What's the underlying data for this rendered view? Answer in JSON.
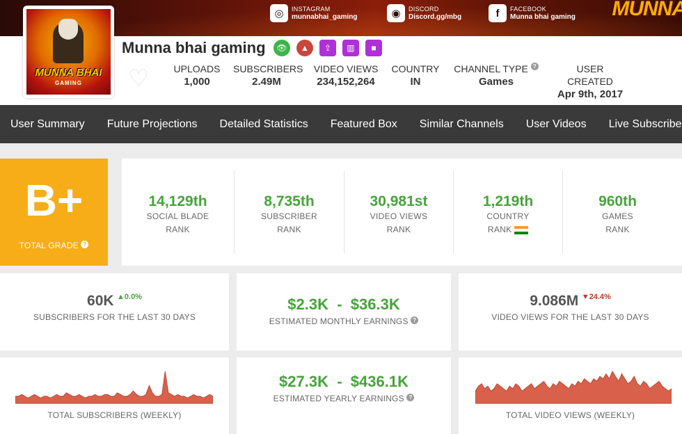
{
  "banner": {
    "instagram": {
      "label": "INSTAGRAM",
      "handle": "munnabhai_gaming"
    },
    "discord": {
      "label": "DISCORD",
      "handle": "Discord.gg/mbg"
    },
    "facebook": {
      "label": "FACEBOOK",
      "handle": "Munna bhai gaming"
    },
    "brand": "MUNNA"
  },
  "channel": {
    "name": "Munna bhai gaming",
    "avatar_text": "MUNNA BHAI",
    "avatar_sub": "GAMING"
  },
  "stats": [
    {
      "label": "UPLOADS",
      "value": "1,000"
    },
    {
      "label": "SUBSCRIBERS",
      "value": "2.49M"
    },
    {
      "label": "VIDEO VIEWS",
      "value": "234,152,264"
    },
    {
      "label": "COUNTRY",
      "value": "IN"
    },
    {
      "label": "CHANNEL TYPE",
      "value": "Games"
    },
    {
      "label": "USER CREATED",
      "value": "Apr 9th, 2017"
    }
  ],
  "nav": [
    "User Summary",
    "Future Projections",
    "Detailed Statistics",
    "Featured Box",
    "Similar Channels",
    "User Videos",
    "Live Subscriber"
  ],
  "grade": {
    "value": "B+",
    "label": "TOTAL GRADE"
  },
  "ranks": [
    {
      "value": "14,129th",
      "line1": "SOCIAL BLADE",
      "line2": "RANK"
    },
    {
      "value": "8,735th",
      "line1": "SUBSCRIBER",
      "line2": "RANK"
    },
    {
      "value": "30,981st",
      "line1": "VIDEO VIEWS",
      "line2": "RANK"
    },
    {
      "value": "1,219th",
      "line1": "COUNTRY",
      "line2": "RANK"
    },
    {
      "value": "960th",
      "line1": "GAMES",
      "line2": "RANK"
    }
  ],
  "cards": {
    "subs30": {
      "value": "60K",
      "delta": "0.0%",
      "caption": "SUBSCRIBERS FOR THE LAST 30 DAYS"
    },
    "monthly": {
      "low": "$2.3K",
      "sep": "-",
      "high": "$36.3K",
      "caption": "ESTIMATED MONTHLY EARNINGS"
    },
    "views30": {
      "value": "9.086M",
      "delta": "24.4%",
      "caption": "VIDEO VIEWS FOR THE LAST 30 DAYS"
    },
    "total_subs": {
      "caption": "TOTAL SUBSCRIBERS (WEEKLY)"
    },
    "yearly": {
      "low": "$27.3K",
      "sep": "-",
      "high": "$436.1K",
      "caption": "ESTIMATED YEARLY EARNINGS"
    },
    "total_views": {
      "caption": "TOTAL VIDEO VIEWS (WEEKLY)"
    }
  },
  "colors": {
    "accent_green": "#46a33b",
    "grade_orange": "#f6ad17",
    "nav_bg": "#3a3a3a",
    "spark_fill": "#d9604a"
  },
  "sparklines": {
    "subscribers": [
      4,
      4,
      5,
      4,
      3,
      4,
      5,
      4,
      3,
      4,
      4,
      3,
      4,
      5,
      4,
      4,
      6,
      5,
      4,
      4,
      5,
      4,
      3,
      4,
      4,
      5,
      4,
      4,
      5,
      5,
      4,
      4,
      6,
      5,
      4,
      4,
      5,
      7,
      5,
      4,
      4,
      5,
      10,
      6,
      4,
      4,
      5,
      18,
      6,
      5,
      4,
      5,
      4,
      4,
      3,
      4,
      5,
      4,
      4,
      3,
      4,
      5,
      4
    ],
    "views": [
      5,
      7,
      8,
      6,
      7,
      5,
      6,
      8,
      7,
      6,
      5,
      7,
      6,
      8,
      7,
      5,
      6,
      7,
      8,
      6,
      7,
      8,
      9,
      7,
      6,
      8,
      7,
      9,
      8,
      7,
      6,
      8,
      7,
      9,
      8,
      10,
      9,
      8,
      10,
      9,
      11,
      10,
      12,
      10,
      13,
      11,
      9,
      12,
      10,
      8,
      9,
      11,
      8,
      7,
      9,
      8,
      6,
      7,
      8,
      9,
      7,
      6,
      5,
      6
    ]
  }
}
